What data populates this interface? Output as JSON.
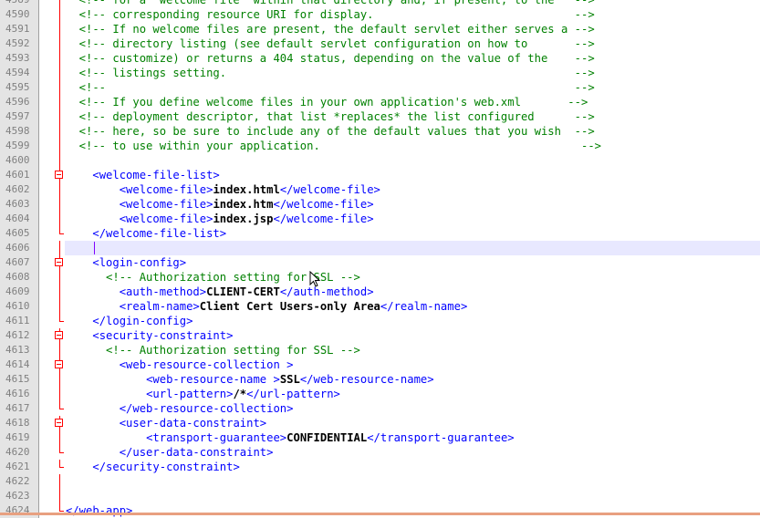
{
  "editor": {
    "current_line": "4606",
    "lines": [
      {
        "num": "4589",
        "fold": "line",
        "segs": [
          {
            "t": "  <!-- for a \"welcome file\" within that directory and, if present, to the   -->",
            "c": "comment"
          }
        ]
      },
      {
        "num": "4590",
        "fold": "line",
        "segs": [
          {
            "t": "  <!-- corresponding resource URI for display.                              -->",
            "c": "comment"
          }
        ]
      },
      {
        "num": "4591",
        "fold": "line",
        "segs": [
          {
            "t": "  <!-- If no welcome files are present, the default servlet either serves a -->",
            "c": "comment"
          }
        ]
      },
      {
        "num": "4592",
        "fold": "line",
        "segs": [
          {
            "t": "  <!-- directory listing (see default servlet configuration on how to       -->",
            "c": "comment"
          }
        ]
      },
      {
        "num": "4593",
        "fold": "line",
        "segs": [
          {
            "t": "  <!-- customize) or returns a 404 status, depending on the value of the    -->",
            "c": "comment"
          }
        ]
      },
      {
        "num": "4594",
        "fold": "line",
        "segs": [
          {
            "t": "  <!-- listings setting.                                                    -->",
            "c": "comment"
          }
        ]
      },
      {
        "num": "4595",
        "fold": "line",
        "segs": [
          {
            "t": "  <!--                                                                      -->",
            "c": "comment"
          }
        ]
      },
      {
        "num": "4596",
        "fold": "line",
        "segs": [
          {
            "t": "  <!-- If you define welcome files in your own application's web.xml       -->",
            "c": "comment"
          }
        ]
      },
      {
        "num": "4597",
        "fold": "line",
        "segs": [
          {
            "t": "  <!-- deployment descriptor, that list *replaces* the list configured      -->",
            "c": "comment"
          }
        ]
      },
      {
        "num": "4598",
        "fold": "line",
        "segs": [
          {
            "t": "  <!-- here, so be sure to include any of the default values that you wish  -->",
            "c": "comment"
          }
        ]
      },
      {
        "num": "4599",
        "fold": "line",
        "segs": [
          {
            "t": "  <!-- to use within your application.                                       -->",
            "c": "comment"
          }
        ]
      },
      {
        "num": "4600",
        "fold": "line",
        "segs": []
      },
      {
        "num": "4601",
        "fold": "box",
        "segs": [
          {
            "t": "    ",
            "c": "plain"
          },
          {
            "t": "<welcome-file-list>",
            "c": "tag"
          }
        ]
      },
      {
        "num": "4602",
        "fold": "line",
        "segs": [
          {
            "t": "        ",
            "c": "plain"
          },
          {
            "t": "<welcome-file>",
            "c": "tag"
          },
          {
            "t": "index.html",
            "c": "text"
          },
          {
            "t": "</welcome-file>",
            "c": "tag"
          }
        ]
      },
      {
        "num": "4603",
        "fold": "line",
        "segs": [
          {
            "t": "        ",
            "c": "plain"
          },
          {
            "t": "<welcome-file>",
            "c": "tag"
          },
          {
            "t": "index.htm",
            "c": "text"
          },
          {
            "t": "</welcome-file>",
            "c": "tag"
          }
        ]
      },
      {
        "num": "4604",
        "fold": "line",
        "segs": [
          {
            "t": "        ",
            "c": "plain"
          },
          {
            "t": "<welcome-file>",
            "c": "tag"
          },
          {
            "t": "index.jsp",
            "c": "text"
          },
          {
            "t": "</welcome-file>",
            "c": "tag"
          }
        ]
      },
      {
        "num": "4605",
        "fold": "end",
        "segs": [
          {
            "t": "    ",
            "c": "plain"
          },
          {
            "t": "</welcome-file-list>",
            "c": "tag"
          }
        ]
      },
      {
        "num": "4606",
        "fold": "line",
        "segs": []
      },
      {
        "num": "4607",
        "fold": "box",
        "segs": [
          {
            "t": "    ",
            "c": "plain"
          },
          {
            "t": "<login-config>",
            "c": "tag"
          }
        ]
      },
      {
        "num": "4608",
        "fold": "line",
        "segs": [
          {
            "t": "      ",
            "c": "plain"
          },
          {
            "t": "<!-- Authorization setting for SSL -->",
            "c": "comment"
          }
        ]
      },
      {
        "num": "4609",
        "fold": "line",
        "segs": [
          {
            "t": "        ",
            "c": "plain"
          },
          {
            "t": "<auth-method>",
            "c": "tag"
          },
          {
            "t": "CLIENT-CERT",
            "c": "text"
          },
          {
            "t": "</auth-method>",
            "c": "tag"
          }
        ]
      },
      {
        "num": "4610",
        "fold": "line",
        "segs": [
          {
            "t": "        ",
            "c": "plain"
          },
          {
            "t": "<realm-name>",
            "c": "tag"
          },
          {
            "t": "Client Cert Users-only Area",
            "c": "text"
          },
          {
            "t": "</realm-name>",
            "c": "tag"
          }
        ]
      },
      {
        "num": "4611",
        "fold": "end",
        "segs": [
          {
            "t": "    ",
            "c": "plain"
          },
          {
            "t": "</login-config>",
            "c": "tag"
          }
        ]
      },
      {
        "num": "4612",
        "fold": "box",
        "segs": [
          {
            "t": "    ",
            "c": "plain"
          },
          {
            "t": "<security-constraint>",
            "c": "tag"
          }
        ]
      },
      {
        "num": "4613",
        "fold": "line",
        "segs": [
          {
            "t": "      ",
            "c": "plain"
          },
          {
            "t": "<!-- Authorization setting for SSL -->",
            "c": "comment"
          }
        ]
      },
      {
        "num": "4614",
        "fold": "box",
        "segs": [
          {
            "t": "        ",
            "c": "plain"
          },
          {
            "t": "<web-resource-collection >",
            "c": "tag"
          }
        ]
      },
      {
        "num": "4615",
        "fold": "line",
        "segs": [
          {
            "t": "            ",
            "c": "plain"
          },
          {
            "t": "<web-resource-name >",
            "c": "tag"
          },
          {
            "t": "SSL",
            "c": "text"
          },
          {
            "t": "</web-resource-name>",
            "c": "tag"
          }
        ]
      },
      {
        "num": "4616",
        "fold": "line",
        "segs": [
          {
            "t": "            ",
            "c": "plain"
          },
          {
            "t": "<url-pattern>",
            "c": "tag"
          },
          {
            "t": "/*",
            "c": "text"
          },
          {
            "t": "</url-pattern>",
            "c": "tag"
          }
        ]
      },
      {
        "num": "4617",
        "fold": "end",
        "segs": [
          {
            "t": "        ",
            "c": "plain"
          },
          {
            "t": "</web-resource-collection>",
            "c": "tag"
          }
        ]
      },
      {
        "num": "4618",
        "fold": "box",
        "segs": [
          {
            "t": "        ",
            "c": "plain"
          },
          {
            "t": "<user-data-constraint>",
            "c": "tag"
          }
        ]
      },
      {
        "num": "4619",
        "fold": "line",
        "segs": [
          {
            "t": "            ",
            "c": "plain"
          },
          {
            "t": "<transport-guarantee>",
            "c": "tag"
          },
          {
            "t": "CONFIDENTIAL",
            "c": "text"
          },
          {
            "t": "</transport-guarantee>",
            "c": "tag"
          }
        ]
      },
      {
        "num": "4620",
        "fold": "end",
        "segs": [
          {
            "t": "        ",
            "c": "plain"
          },
          {
            "t": "</user-data-constraint>",
            "c": "tag"
          }
        ]
      },
      {
        "num": "4621",
        "fold": "end",
        "segs": [
          {
            "t": "    ",
            "c": "plain"
          },
          {
            "t": "</security-constraint>",
            "c": "tag"
          }
        ]
      },
      {
        "num": "4622",
        "fold": "line",
        "segs": []
      },
      {
        "num": "4623",
        "fold": "line",
        "segs": []
      },
      {
        "num": "4624",
        "fold": "end",
        "segs": [
          {
            "t": "</web-app>",
            "c": "tag"
          }
        ]
      }
    ]
  }
}
